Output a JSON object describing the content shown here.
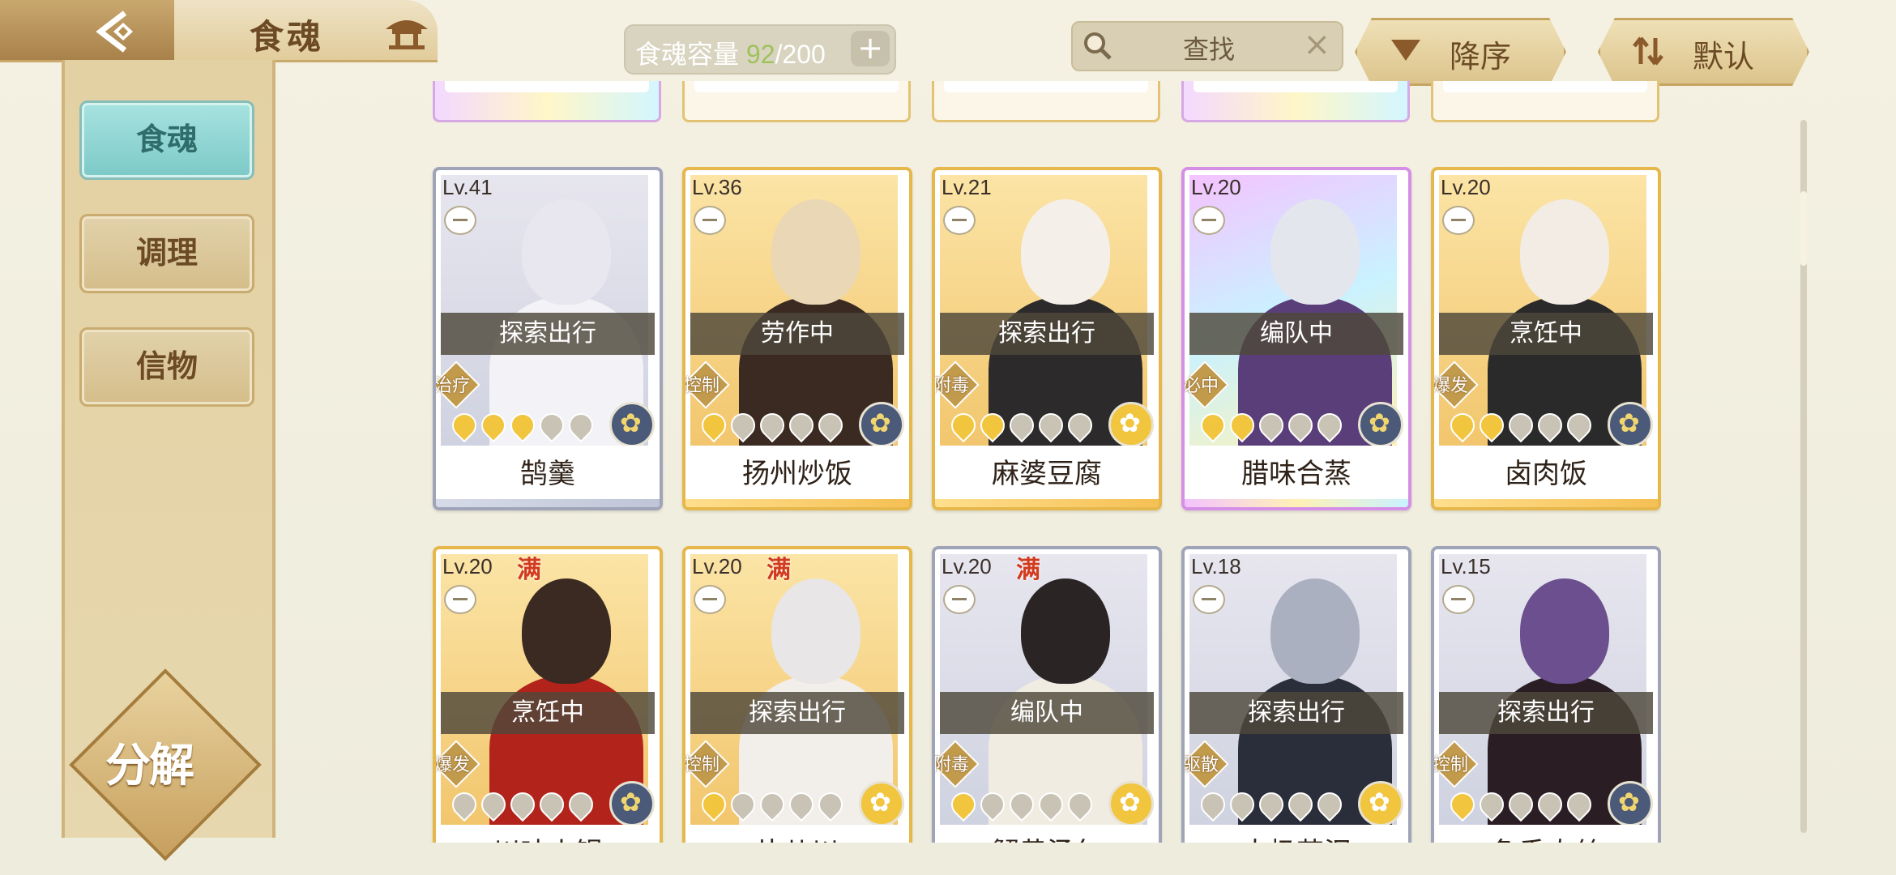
{
  "header": {
    "title": "食魂",
    "capacity": {
      "label": "食魂容量",
      "current": "92",
      "total": "/200",
      "add": "+"
    },
    "search": {
      "placeholder": "查找",
      "clear": "×"
    },
    "sort_label": "降序",
    "default_label": "默认"
  },
  "sidebar": {
    "items": [
      {
        "label": "食魂",
        "active": true
      },
      {
        "label": "调理",
        "active": false
      },
      {
        "label": "信物",
        "active": false
      }
    ],
    "decompose_label": "分解"
  },
  "cards": [
    {
      "lv": "Lv.41",
      "status": "探索出行",
      "type": "治疗",
      "name": "鹄羹",
      "stars": 3,
      "max": false,
      "rarity": "silver",
      "flower": "blue"
    },
    {
      "lv": "Lv.36",
      "status": "劳作中",
      "type": "控制",
      "name": "扬州炒饭",
      "stars": 1,
      "max": false,
      "rarity": "gold",
      "flower": "blue"
    },
    {
      "lv": "Lv.21",
      "status": "探索出行",
      "type": "附毒",
      "name": "麻婆豆腐",
      "stars": 2,
      "max": false,
      "rarity": "gold",
      "flower": "gold"
    },
    {
      "lv": "Lv.20",
      "status": "编队中",
      "type": "必中",
      "name": "腊味合蒸",
      "stars": 2,
      "max": false,
      "rarity": "rainbow",
      "flower": "blue"
    },
    {
      "lv": "Lv.20",
      "status": "烹饪中",
      "type": "爆发",
      "name": "卤肉饭",
      "stars": 2,
      "max": false,
      "rarity": "gold",
      "flower": "blue"
    },
    {
      "lv": "Lv.20",
      "status": "烹饪中",
      "type": "爆发",
      "name": "川味火锅",
      "stars": 0,
      "max": true,
      "man": "满",
      "rarity": "gold",
      "flower": "blue"
    },
    {
      "lv": "Lv.20",
      "status": "探索出行",
      "type": "控制",
      "name": "片儿川",
      "stars": 1,
      "max": true,
      "man": "满",
      "rarity": "gold",
      "flower": "gold"
    },
    {
      "lv": "Lv.20",
      "status": "编队中",
      "type": "附毒",
      "name": "蟹黄汤包",
      "stars": 1,
      "max": true,
      "man": "满",
      "rarity": "silver",
      "flower": "gold"
    },
    {
      "lv": "Lv.18",
      "status": "探索出行",
      "type": "驱散",
      "name": "太极芋泥",
      "stars": 0,
      "max": false,
      "rarity": "silver",
      "flower": "gold"
    },
    {
      "lv": "Lv.15",
      "status": "探索出行",
      "type": "控制",
      "name": "鱼香肉丝",
      "stars": 1,
      "max": false,
      "rarity": "silver",
      "flower": "blue"
    }
  ],
  "colors": {
    "accent_teal": "#7cc9c7",
    "gold_border": "#e6b84c",
    "status_overlay": "#4e483a"
  }
}
